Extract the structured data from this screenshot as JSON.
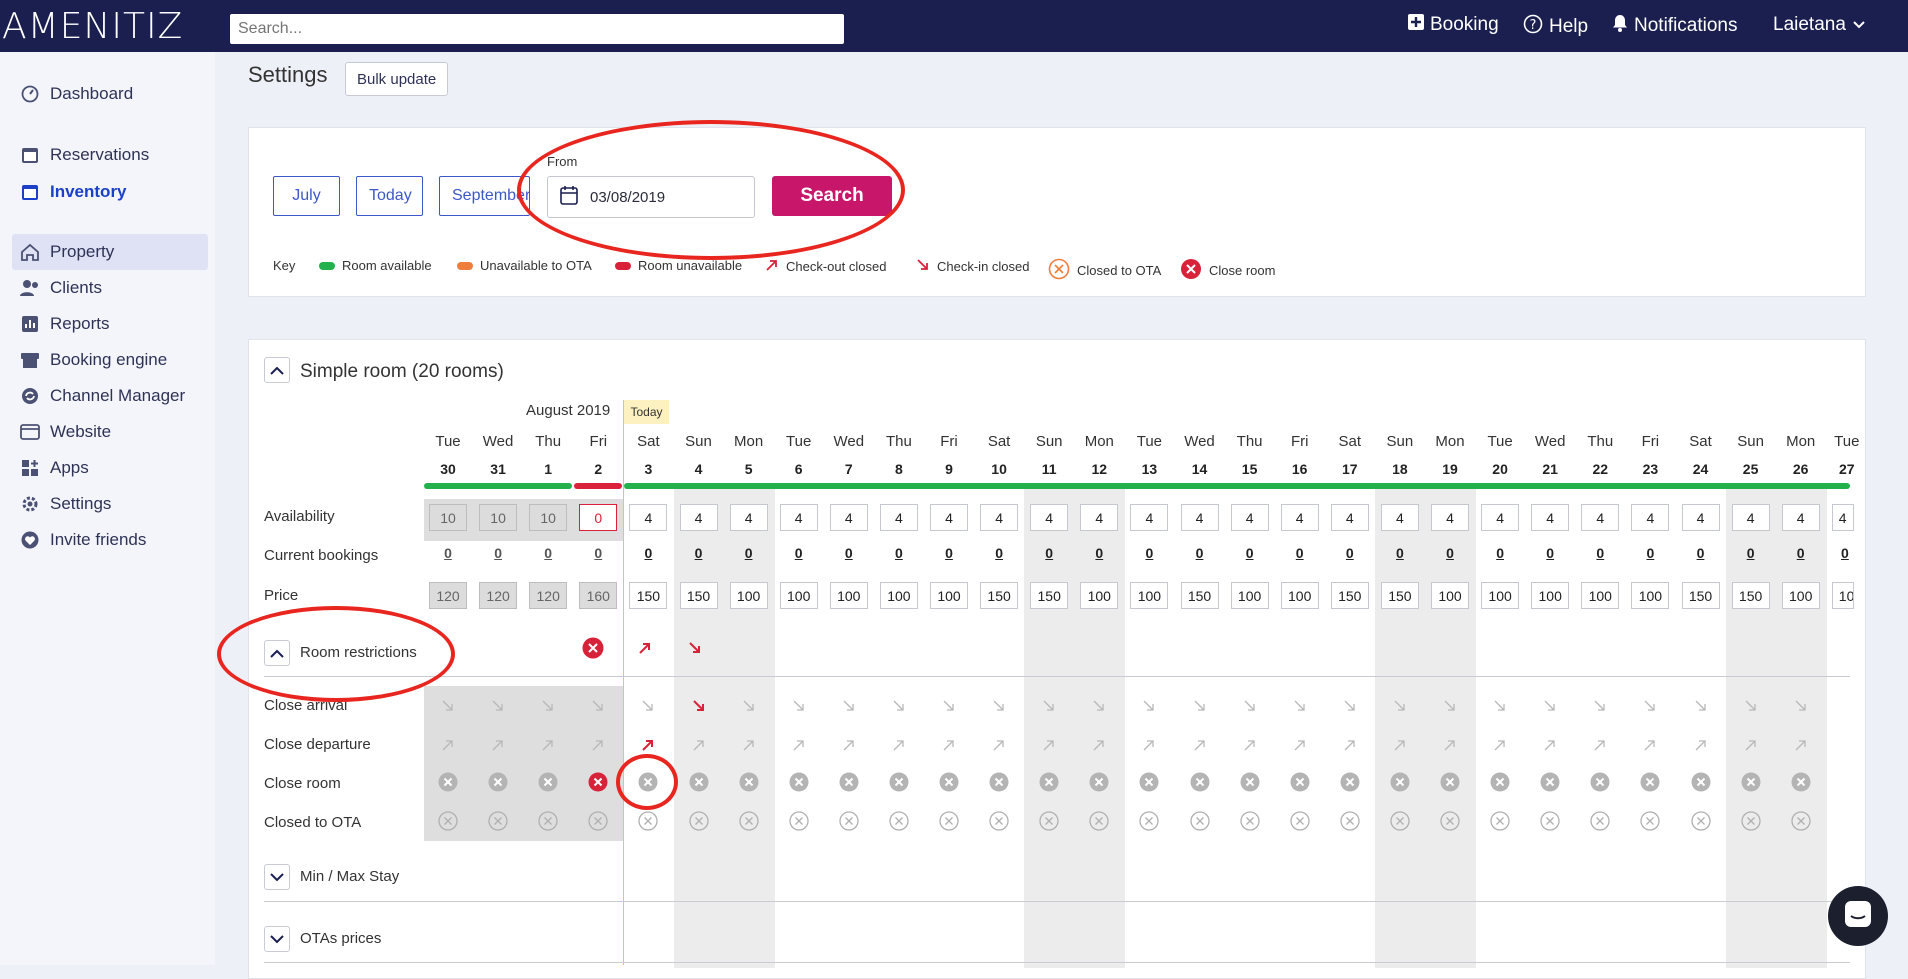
{
  "topbar": {
    "logo": "AMENITIZ",
    "search_placeholder": "Search...",
    "booking": "Booking",
    "help": "Help",
    "notifications": "Notifications",
    "user": "Laietana"
  },
  "sidebar": {
    "items": [
      {
        "label": "Dashboard",
        "icon": "gauge-icon"
      },
      {
        "label": "Reservations",
        "icon": "calendar-check-icon"
      },
      {
        "label": "Inventory",
        "icon": "calendar-icon"
      },
      {
        "label": "Property",
        "icon": "home-icon"
      },
      {
        "label": "Clients",
        "icon": "users-icon"
      },
      {
        "label": "Reports",
        "icon": "chart-icon"
      },
      {
        "label": "Booking engine",
        "icon": "store-icon"
      },
      {
        "label": "Channel Manager",
        "icon": "sync-icon"
      },
      {
        "label": "Website",
        "icon": "browser-icon"
      },
      {
        "label": "Apps",
        "icon": "apps-icon"
      },
      {
        "label": "Settings",
        "icon": "gear-icon"
      },
      {
        "label": "Invite friends",
        "icon": "heart-icon"
      }
    ]
  },
  "page": {
    "title": "Settings",
    "bulk_update": "Bulk update"
  },
  "filters": {
    "prev": "July",
    "today": "Today",
    "next": "September",
    "from_label": "From",
    "from_value": "03/08/2019",
    "search": "Search"
  },
  "legend": {
    "key": "Key",
    "items": [
      "Room available",
      "Unavailable to OTA",
      "Room unavailable",
      "Check-out closed",
      "Check-in closed",
      "Closed to OTA",
      "Close room"
    ]
  },
  "colors": {
    "accent": "#c8176b",
    "nav": "#1a1f4f",
    "available": "#22b14c",
    "ota": "#ef7d3c",
    "unavailable": "#d8223a"
  },
  "room": {
    "title": "Simple room (20 rooms)",
    "month": "August 2019",
    "today_badge": "Today"
  },
  "rows": {
    "availability": "Availability",
    "bookings": "Current bookings",
    "price": "Price",
    "restrictions": "Room restrictions",
    "close_arrival": "Close arrival",
    "close_departure": "Close departure",
    "close_room": "Close room",
    "closed_ota": "Closed to OTA",
    "minmax": "Min / Max Stay",
    "ota_prices": "OTAs prices"
  },
  "days": [
    {
      "d": "Tue",
      "n": "30",
      "avail": "10",
      "book": "0",
      "price": "120"
    },
    {
      "d": "Wed",
      "n": "31",
      "avail": "10",
      "book": "0",
      "price": "120"
    },
    {
      "d": "Thu",
      "n": "1",
      "avail": "10",
      "book": "0",
      "price": "120"
    },
    {
      "d": "Fri",
      "n": "2",
      "avail": "0",
      "book": "0",
      "price": "160"
    },
    {
      "d": "Sat",
      "n": "3",
      "avail": "4",
      "book": "0",
      "price": "150"
    },
    {
      "d": "Sun",
      "n": "4",
      "avail": "4",
      "book": "0",
      "price": "150"
    },
    {
      "d": "Mon",
      "n": "5",
      "avail": "4",
      "book": "0",
      "price": "100"
    },
    {
      "d": "Tue",
      "n": "6",
      "avail": "4",
      "book": "0",
      "price": "100"
    },
    {
      "d": "Wed",
      "n": "7",
      "avail": "4",
      "book": "0",
      "price": "100"
    },
    {
      "d": "Thu",
      "n": "8",
      "avail": "4",
      "book": "0",
      "price": "100"
    },
    {
      "d": "Fri",
      "n": "9",
      "avail": "4",
      "book": "0",
      "price": "100"
    },
    {
      "d": "Sat",
      "n": "10",
      "avail": "4",
      "book": "0",
      "price": "150"
    },
    {
      "d": "Sun",
      "n": "11",
      "avail": "4",
      "book": "0",
      "price": "150"
    },
    {
      "d": "Mon",
      "n": "12",
      "avail": "4",
      "book": "0",
      "price": "100"
    },
    {
      "d": "Tue",
      "n": "13",
      "avail": "4",
      "book": "0",
      "price": "100"
    },
    {
      "d": "Wed",
      "n": "14",
      "avail": "4",
      "book": "0",
      "price": "150"
    },
    {
      "d": "Thu",
      "n": "15",
      "avail": "4",
      "book": "0",
      "price": "100"
    },
    {
      "d": "Fri",
      "n": "16",
      "avail": "4",
      "book": "0",
      "price": "100"
    },
    {
      "d": "Sat",
      "n": "17",
      "avail": "4",
      "book": "0",
      "price": "150"
    },
    {
      "d": "Sun",
      "n": "18",
      "avail": "4",
      "book": "0",
      "price": "150"
    },
    {
      "d": "Mon",
      "n": "19",
      "avail": "4",
      "book": "0",
      "price": "100"
    },
    {
      "d": "Tue",
      "n": "20",
      "avail": "4",
      "book": "0",
      "price": "100"
    },
    {
      "d": "Wed",
      "n": "21",
      "avail": "4",
      "book": "0",
      "price": "100"
    },
    {
      "d": "Thu",
      "n": "22",
      "avail": "4",
      "book": "0",
      "price": "100"
    },
    {
      "d": "Fri",
      "n": "23",
      "avail": "4",
      "book": "0",
      "price": "100"
    },
    {
      "d": "Sat",
      "n": "24",
      "avail": "4",
      "book": "0",
      "price": "150"
    },
    {
      "d": "Sun",
      "n": "25",
      "avail": "4",
      "book": "0",
      "price": "150"
    },
    {
      "d": "Mon",
      "n": "26",
      "avail": "4",
      "book": "0",
      "price": "100"
    },
    {
      "d": "Tue",
      "n": "27",
      "avail": "4",
      "book": "0",
      "price": "10"
    }
  ]
}
